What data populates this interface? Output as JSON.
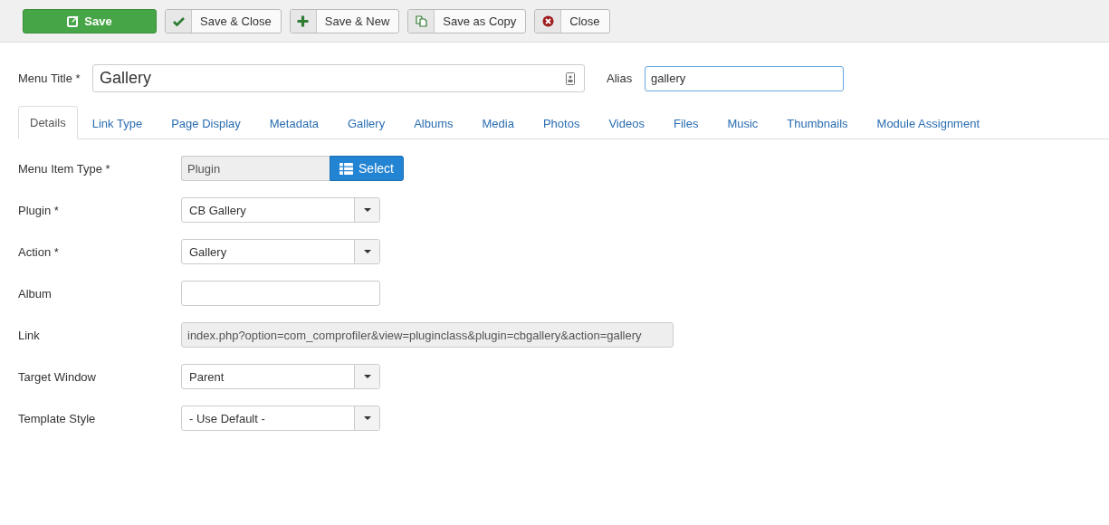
{
  "toolbar": [
    {
      "label": "Save",
      "kind": "primary"
    },
    {
      "label": "Save & Close",
      "kind": "default"
    },
    {
      "label": "Save & New",
      "kind": "default"
    },
    {
      "label": "Save as Copy",
      "kind": "default"
    },
    {
      "label": "Close",
      "kind": "default"
    }
  ],
  "title_field": {
    "label": "Menu Title *",
    "value": "Gallery"
  },
  "alias_field": {
    "label": "Alias",
    "value": "gallery"
  },
  "tabs": [
    {
      "label": "Details",
      "selected": true
    },
    {
      "label": "Link Type",
      "selected": false
    },
    {
      "label": "Page Display",
      "selected": false
    },
    {
      "label": "Metadata",
      "selected": false
    },
    {
      "label": "Gallery",
      "selected": false
    },
    {
      "label": "Albums",
      "selected": false
    },
    {
      "label": "Media",
      "selected": false
    },
    {
      "label": "Photos",
      "selected": false
    },
    {
      "label": "Videos",
      "selected": false
    },
    {
      "label": "Files",
      "selected": false
    },
    {
      "label": "Music",
      "selected": false
    },
    {
      "label": "Thumbnails",
      "selected": false
    },
    {
      "label": "Module Assignment",
      "selected": false
    }
  ],
  "fields": [
    {
      "label": "Menu Item Type *",
      "kind": "picker",
      "value": "Plugin",
      "button": "Select"
    },
    {
      "label": "Plugin *",
      "kind": "select",
      "value": "CB Gallery"
    },
    {
      "label": "Action *",
      "kind": "select",
      "value": "Gallery"
    },
    {
      "label": "Album",
      "kind": "text"
    },
    {
      "label": "Link",
      "kind": "readonly",
      "value": "index.php?option=com_comprofiler&view=pluginclass&plugin=cbgallery&action=gallery"
    },
    {
      "label": "Target Window",
      "kind": "select",
      "value": "Parent"
    },
    {
      "label": "Template Style",
      "kind": "select",
      "value": "- Use Default -"
    }
  ]
}
